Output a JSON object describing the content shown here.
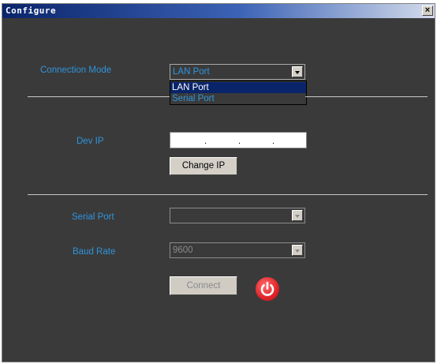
{
  "window": {
    "title": "Configure",
    "close_label": "×"
  },
  "connection_mode": {
    "label": "Connection Mode",
    "selected": "LAN Port",
    "options": [
      "LAN Port",
      "Serial Port"
    ]
  },
  "dev_ip": {
    "label": "Dev IP",
    "dot": ".",
    "change_ip_button": "Change  IP"
  },
  "serial_port": {
    "label": "Serial Port",
    "value": ""
  },
  "baud_rate": {
    "label": "Baud Rate",
    "value": "9600"
  },
  "connect_button": "Connect",
  "colors": {
    "label_blue": "#2f95dd",
    "panel": "#3a3a3a",
    "power_red": "#e0242a"
  }
}
